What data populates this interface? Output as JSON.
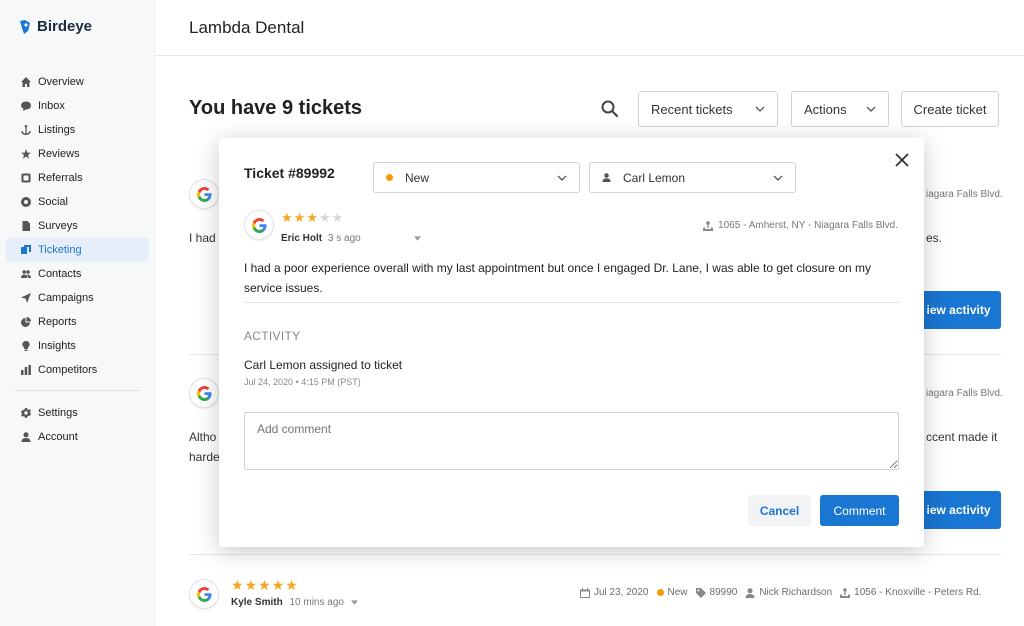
{
  "brand": {
    "name": "Birdeye"
  },
  "header": {
    "title": "Lambda Dental"
  },
  "sidebar": {
    "items": [
      {
        "label": "Overview",
        "icon": "home-icon"
      },
      {
        "label": "Inbox",
        "icon": "chat-icon"
      },
      {
        "label": "Listings",
        "icon": "anchor-icon"
      },
      {
        "label": "Reviews",
        "icon": "star-icon"
      },
      {
        "label": "Referrals",
        "icon": "referral-icon"
      },
      {
        "label": "Social",
        "icon": "social-icon"
      },
      {
        "label": "Surveys",
        "icon": "survey-icon"
      },
      {
        "label": "Ticketing",
        "icon": "ticket-icon",
        "active": true
      },
      {
        "label": "Contacts",
        "icon": "people-icon"
      },
      {
        "label": "Campaigns",
        "icon": "send-icon"
      },
      {
        "label": "Reports",
        "icon": "pie-icon"
      },
      {
        "label": "Insights",
        "icon": "bulb-icon"
      },
      {
        "label": "Competitors",
        "icon": "bars-icon"
      }
    ],
    "bottom_items": [
      {
        "label": "Settings",
        "icon": "gear-icon"
      },
      {
        "label": "Account",
        "icon": "user-icon"
      }
    ]
  },
  "main": {
    "title": "You have 9 tickets",
    "filter_label": "Recent tickets",
    "actions_label": "Actions",
    "create_label": "Create ticket",
    "tickets": [
      {
        "text_visible": "I had",
        "text_right": "es.",
        "location": "iagara Falls Blvd.",
        "button": "iew activity"
      },
      {
        "text_visible_1": "Altho",
        "text_visible_2": "harde",
        "text_right": "ccent made it",
        "location": "iagara Falls Blvd.",
        "button": "iew activity"
      }
    ],
    "last_ticket": {
      "reviewer": "Kyle Smith",
      "ago": "10 mins ago",
      "rating": 5,
      "date": "Jul 23, 2020",
      "status": "New",
      "ticket_id": "89990",
      "assignee": "Nick Richardson",
      "location": "1056 - Knoxville - Peters Rd."
    }
  },
  "modal": {
    "title": "Ticket #89992",
    "status": "New",
    "assignee": "Carl Lemon",
    "reviewer": "Eric Holt",
    "ago": "3 s ago",
    "rating": 3,
    "location": "1065 - Amherst, NY - Niagara Falls Blvd.",
    "review": "I had a poor experience overall with my last appointment but once I engaged Dr. Lane, I was able to get closure on my service issues.",
    "activity_label": "ACTIVITY",
    "activity_text": "Carl Lemon assigned to ticket",
    "activity_time": "Jul 24, 2020 • 4:15 PM (PST)",
    "comment_placeholder": "Add comment",
    "cancel_label": "Cancel",
    "comment_label": "Comment"
  },
  "colors": {
    "accent": "#1976d2",
    "status_new": "#f59b00",
    "star": "#f5a623"
  }
}
